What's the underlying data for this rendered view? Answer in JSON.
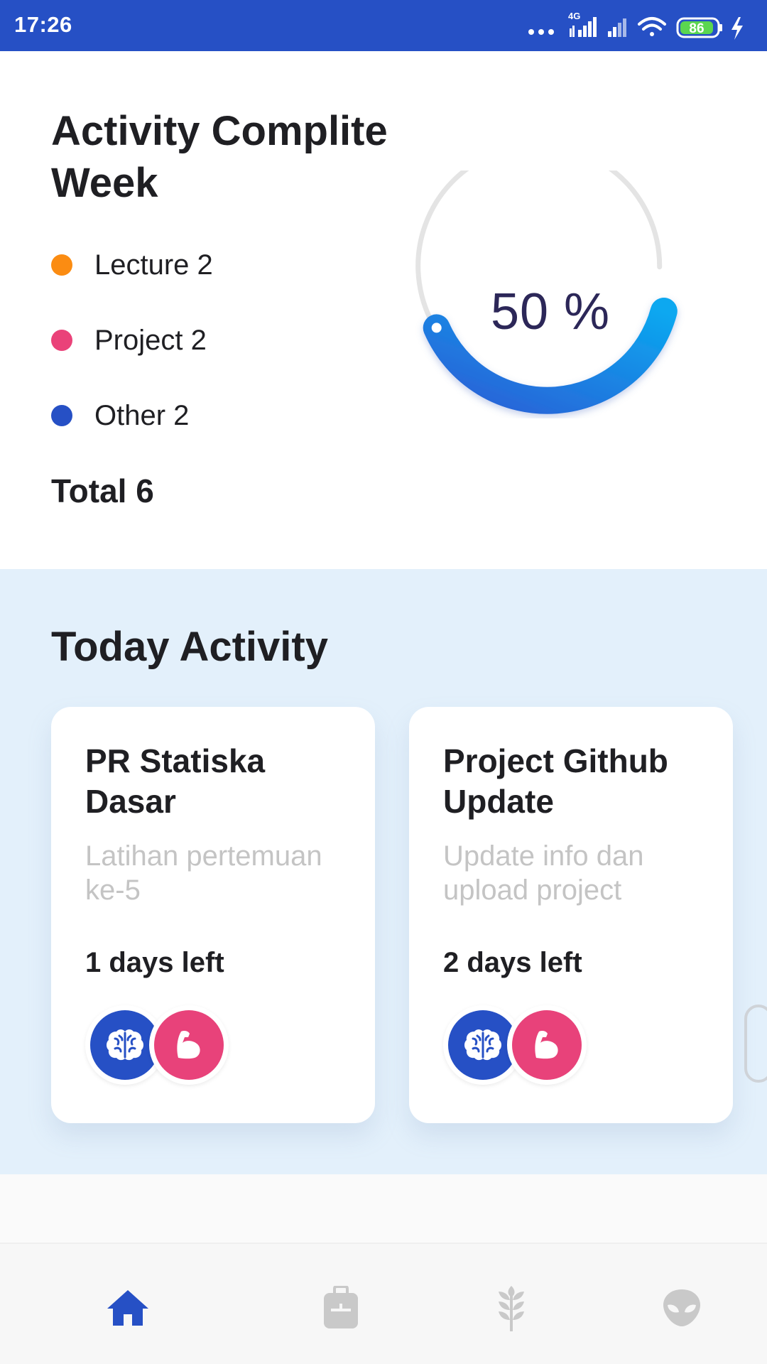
{
  "status_bar": {
    "time": "17:26",
    "network": "4G",
    "battery": "86",
    "icons": [
      "more-dots-icon",
      "signal-4g-icon",
      "signal-icon",
      "wifi-icon",
      "battery-icon",
      "charging-icon"
    ]
  },
  "summary": {
    "title": "Activity Complite Week",
    "legend": [
      {
        "label": "Lecture 2",
        "color": "#fb8c12"
      },
      {
        "label": "Project 2",
        "color": "#ea4279"
      },
      {
        "label": "Other 2",
        "color": "#2650c5"
      }
    ],
    "total": "Total 6",
    "progress_text": "50 %",
    "progress_value": 0.5
  },
  "today": {
    "title": "Today Activity",
    "cards": [
      {
        "title": "PR Statiska Dasar",
        "description": "Latihan pertemuan ke-5",
        "days_left": "1 days left",
        "badges": [
          "brain-icon",
          "muscle-icon"
        ]
      },
      {
        "title": "Project Github Update",
        "description": "Update info dan upload project",
        "days_left": "2 days left",
        "badges": [
          "brain-icon",
          "muscle-icon"
        ]
      }
    ]
  },
  "bottom_nav": {
    "items": [
      {
        "icon": "home-icon",
        "active": true
      },
      {
        "icon": "briefcase-icon",
        "active": false
      },
      {
        "icon": "wheat-icon",
        "active": false
      },
      {
        "icon": "alien-icon",
        "active": false
      }
    ]
  },
  "colors": {
    "status_bar": "#2650c5",
    "accent_blue": "#2650c5",
    "accent_pink": "#e8427a",
    "accent_orange": "#fb8c12",
    "gauge_gradient_start": "#2b5fd6",
    "gauge_gradient_end": "#0aa8f0",
    "section_bg": "#e3f0fb"
  }
}
